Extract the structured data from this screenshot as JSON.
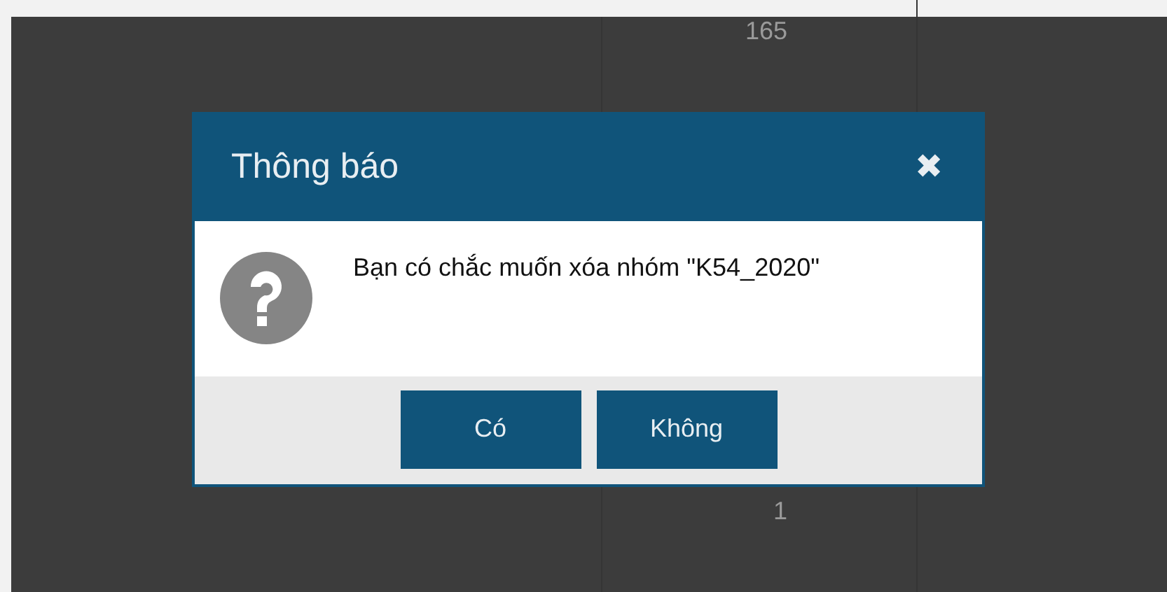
{
  "background_table": {
    "cells": [
      {
        "value": "165"
      },
      {
        "value": "1"
      }
    ]
  },
  "dialog": {
    "title": "Thông báo",
    "close": "✖",
    "message": "Bạn có chắc muốn xóa nhóm \"K54_2020\"",
    "buttons": [
      {
        "label": "Có"
      },
      {
        "label": "Không"
      }
    ]
  }
}
